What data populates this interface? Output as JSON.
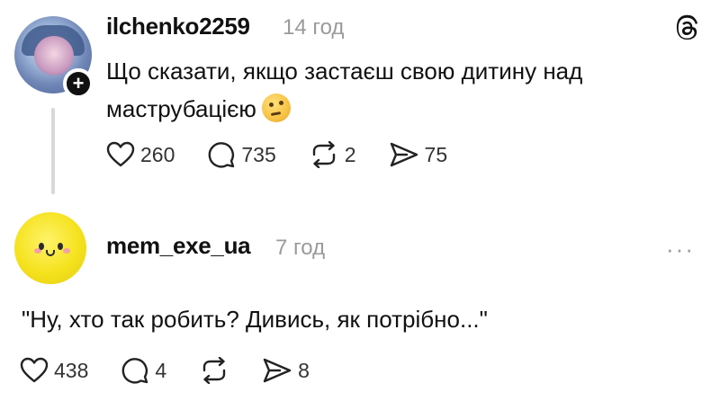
{
  "post": {
    "username": "ilchenko2259",
    "time": "14 год",
    "text": "Що сказати, якщо застаєш свою дитину над маструбацією",
    "emoji": "thinking-face",
    "stats": {
      "likes": "260",
      "comments": "735",
      "reposts": "2",
      "shares": "75"
    },
    "follow_badge": "+"
  },
  "reply": {
    "username": "mem_exe_ua",
    "time": "7 год",
    "text": "\"Ну, хто так робить? Дивись, як потрібно...\"",
    "stats": {
      "likes": "438",
      "comments": "4",
      "shares": "8"
    },
    "more": "···"
  },
  "icons": [
    "heart-icon",
    "comment-icon",
    "repost-icon",
    "share-icon",
    "threads-logo-icon",
    "more-icon"
  ],
  "colors": {
    "text": "#111111",
    "muted": "#9a9a9a",
    "thread_line": "#d8d8d8",
    "avatar_yellow": "#f5e21e"
  }
}
